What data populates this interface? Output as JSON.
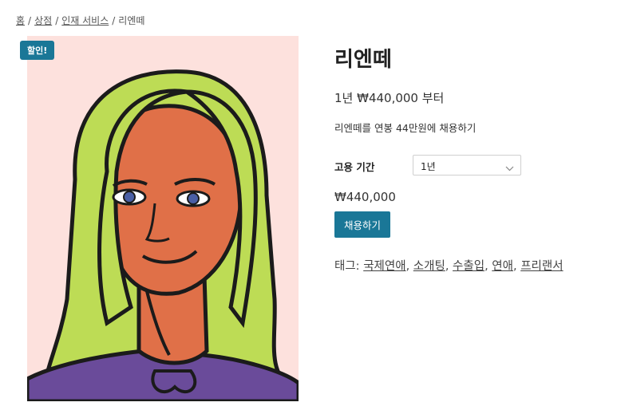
{
  "breadcrumb": {
    "items": [
      "홈",
      "상점",
      "인재 서비스",
      "리엔떼"
    ],
    "separator": "/"
  },
  "product": {
    "sale_badge": "할인!",
    "title": "리엔떼",
    "price_from": "1년 ₩440,000 부터",
    "short_description": "리엔떼를 연봉 44만원에 채용하기",
    "variation": {
      "label": "고용 기간",
      "selected": "1년"
    },
    "variant_price": "₩440,000",
    "hire_button": "채용하기",
    "tags_label": "태그:",
    "tags": [
      "국제연애",
      "소개팅",
      "수출입",
      "연애",
      "프리랜서"
    ]
  },
  "colors": {
    "accent": "#1a7797",
    "image_background": "#fde1dd",
    "hair": "#bddc55",
    "skin": "#e07048",
    "shirt": "#6a4b9a"
  },
  "icons": {
    "select_arrow": "chevron-down-icon"
  }
}
